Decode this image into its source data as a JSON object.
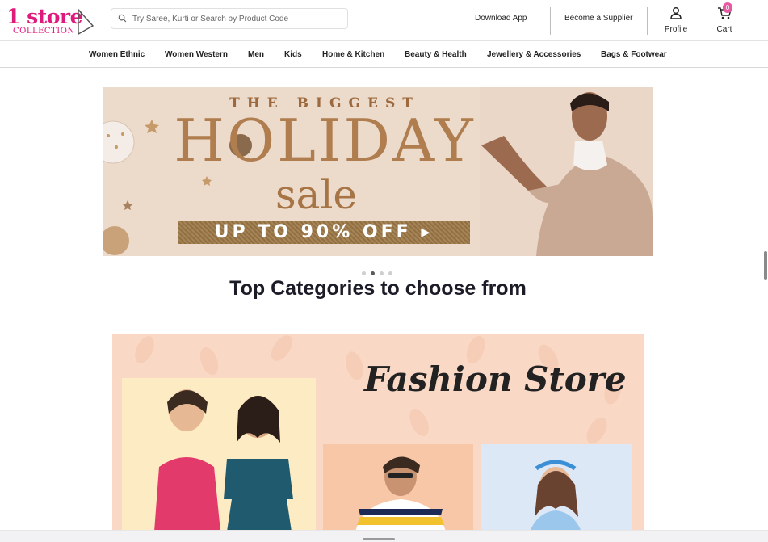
{
  "brand": {
    "logo_main": "1 store",
    "logo_sub": "COLLECTION",
    "pink": "#e0197d"
  },
  "search": {
    "placeholder": "Try Saree, Kurti or Search by Product Code",
    "icon": "search-icon"
  },
  "header": {
    "download_app": "Download App",
    "become_supplier": "Become a Supplier",
    "profile": "Profile",
    "cart": "Cart",
    "cart_count": "0"
  },
  "nav": {
    "items": [
      "Women Ethnic",
      "Women Western",
      "Men",
      "Kids",
      "Home & Kitchen",
      "Beauty & Health",
      "Jewellery & Accessories",
      "Bags & Footwear"
    ]
  },
  "banner": {
    "line1": "THE BIGGEST",
    "line2": "HOLIDAY",
    "line3": "sale",
    "offer": "UP TO 90% OFF ▸",
    "slides": 4,
    "active_slide": 2
  },
  "categories": {
    "title": "Top Categories to choose from",
    "fashion_title": "Fashion Store"
  }
}
